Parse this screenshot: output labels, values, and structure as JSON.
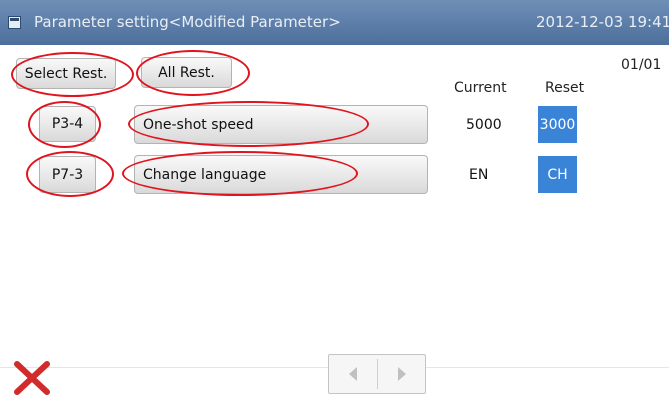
{
  "header": {
    "title": "Parameter setting<Modified Parameter>",
    "datetime": "2012-12-03  19:41"
  },
  "page_indicator": "01/01",
  "toolbar": {
    "select_reset_label": "Select Rest.",
    "all_reset_label": "All Rest."
  },
  "columns": {
    "current": "Current",
    "reset": "Reset"
  },
  "params": [
    {
      "code": "P3-4",
      "name": "One-shot speed",
      "current": "5000",
      "reset": "3000"
    },
    {
      "code": "P7-3",
      "name": "Change language",
      "current": "EN",
      "reset": "CH"
    }
  ],
  "icons": {
    "title": "window-icon",
    "close": "close-icon",
    "prev": "arrow-left-icon",
    "next": "arrow-right-icon"
  },
  "colors": {
    "titlebar": "#5b7da8",
    "reset_highlight": "#3a84d8",
    "annotation": "#e0141e",
    "close_red": "#d22b2b"
  }
}
